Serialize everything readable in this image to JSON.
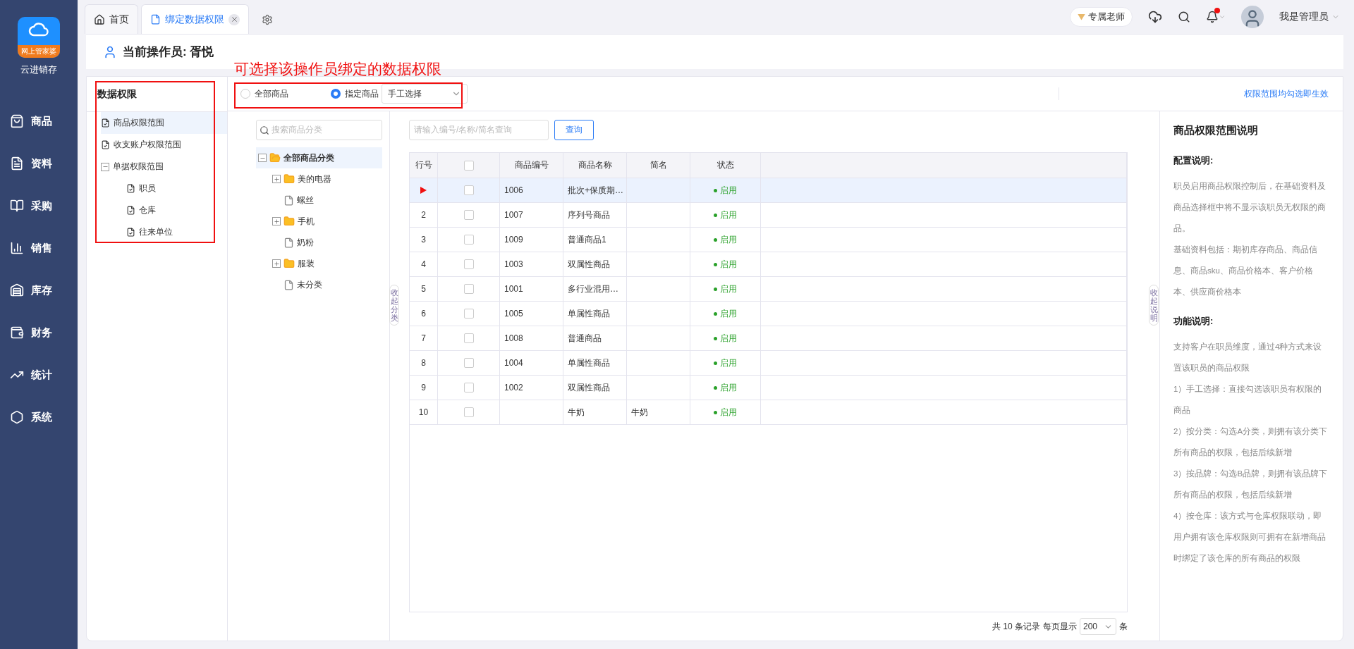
{
  "app": {
    "logo_caption": "网上管家婆",
    "name": "云进销存"
  },
  "nav": [
    {
      "label": "商品",
      "selected": false
    },
    {
      "label": "资料",
      "selected": false
    },
    {
      "label": "采购",
      "selected": false
    },
    {
      "label": "销售",
      "selected": false
    },
    {
      "label": "库存",
      "selected": false
    },
    {
      "label": "财务",
      "selected": false
    },
    {
      "label": "统计",
      "selected": false
    },
    {
      "label": "系统",
      "selected": false
    }
  ],
  "tabs": [
    {
      "label": "首页",
      "kind": "home",
      "selected": false,
      "closable": false
    },
    {
      "label": "绑定数据权限",
      "kind": "page",
      "selected": true,
      "closable": true
    }
  ],
  "topbar": {
    "teacher": "专属老师",
    "unread": true,
    "user": "我是管理员"
  },
  "operator": "当前操作员: 胥悦",
  "annotation": "可选择该操作员绑定的数据权限",
  "permission_panel": {
    "title": "数据权限",
    "items": [
      {
        "label": "商品权限范围",
        "kind": "leaf",
        "selected": true
      },
      {
        "label": "收支账户权限范围",
        "kind": "leaf",
        "selected": false
      },
      {
        "label": "单据权限范围",
        "kind": "group",
        "selected": false,
        "expanded": true,
        "children": [
          {
            "label": "职员",
            "kind": "leaf",
            "selected": false
          },
          {
            "label": "仓库",
            "kind": "leaf",
            "selected": false
          },
          {
            "label": "往来单位",
            "kind": "leaf",
            "selected": false
          }
        ]
      }
    ]
  },
  "scope": {
    "options": [
      {
        "label": "全部商品",
        "selected": false
      },
      {
        "label": "指定商品",
        "selected": true
      }
    ],
    "mode": "手工选择",
    "notice": "权限范围均勾选即生效"
  },
  "category_tree": {
    "search_placeholder": "搜索商品分类",
    "items": [
      {
        "label": "全部商品分类",
        "kind": "folder",
        "expanded": true,
        "selected": true,
        "children": [
          {
            "label": "美的电器",
            "kind": "folder",
            "expanded": false,
            "selected": false
          },
          {
            "label": "螺丝",
            "kind": "file",
            "selected": false
          },
          {
            "label": "手机",
            "kind": "folder",
            "expanded": false,
            "selected": false
          },
          {
            "label": "奶粉",
            "kind": "file",
            "selected": false
          },
          {
            "label": "服装",
            "kind": "folder",
            "expanded": false,
            "selected": false
          },
          {
            "label": "未分类",
            "kind": "file",
            "selected": false
          }
        ]
      }
    ]
  },
  "collapse_category": "收起分类",
  "collapse_info": "收起说明",
  "query": {
    "placeholder": "请输入编号/名称/简名查询",
    "button": "查询"
  },
  "table": {
    "columns": [
      "行号",
      "商品编号",
      "商品名称",
      "简名",
      "状态"
    ],
    "all_checked": false,
    "rows": [
      {
        "current": true,
        "checked": false,
        "code": "1006",
        "name": "批次+保质期…",
        "short": "",
        "status": "启用"
      },
      {
        "no": "2",
        "current": false,
        "checked": false,
        "code": "1007",
        "name": "序列号商品",
        "short": "",
        "status": "启用"
      },
      {
        "no": "3",
        "current": false,
        "checked": false,
        "code": "1009",
        "name": "普通商品1",
        "short": "",
        "status": "启用"
      },
      {
        "no": "4",
        "current": false,
        "checked": false,
        "code": "1003",
        "name": "双属性商品",
        "short": "",
        "status": "启用"
      },
      {
        "no": "5",
        "current": false,
        "checked": false,
        "code": "1001",
        "name": "多行业混用…",
        "short": "",
        "status": "启用"
      },
      {
        "no": "6",
        "current": false,
        "checked": false,
        "code": "1005",
        "name": "单属性商品",
        "short": "",
        "status": "启用"
      },
      {
        "no": "7",
        "current": false,
        "checked": false,
        "code": "1008",
        "name": "普通商品",
        "short": "",
        "status": "启用"
      },
      {
        "no": "8",
        "current": false,
        "checked": false,
        "code": "1004",
        "name": "单属性商品",
        "short": "",
        "status": "启用"
      },
      {
        "no": "9",
        "current": false,
        "checked": false,
        "code": "1002",
        "name": "双属性商品",
        "short": "",
        "status": "启用"
      },
      {
        "no": "10",
        "current": false,
        "checked": false,
        "code": "",
        "name": "牛奶",
        "short": "牛奶",
        "status": "启用"
      }
    ]
  },
  "pagination": {
    "total": "共 10 条记录",
    "per_page_label": "每页显示",
    "per_page": "200",
    "unit": "条"
  },
  "info": {
    "title": "商品权限范围说明",
    "sections": [
      {
        "heading": "配置说明:",
        "paragraphs": [
          "职员启用商品权限控制后，在基础资料及商品选择框中将不显示该职员无权限的商品。",
          "基础资料包括：期初库存商品、商品信息、商品sku、商品价格本、客户价格本、供应商价格本"
        ]
      },
      {
        "heading": "功能说明:",
        "paragraphs": [
          "支持客户在职员维度，通过4种方式来设置该职员的商品权限",
          "1）手工选择：直接勾选该职员有权限的商品",
          "2）按分类：勾选A分类，则拥有该分类下所有商品的权限，包括后续新增",
          "3）按品牌：勾选B品牌，则拥有该品牌下所有商品的权限，包括后续新增",
          "4）按仓库：该方式与仓库权限联动，即用户拥有该仓库权限则可拥有在新增商品时绑定了该仓库的所有商品的权限"
        ]
      }
    ]
  }
}
